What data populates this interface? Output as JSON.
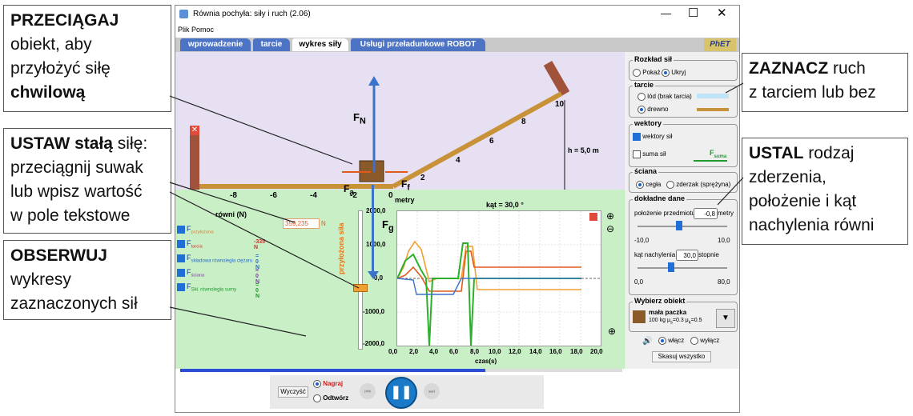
{
  "callouts": {
    "drag": {
      "bold": "PRZECIĄGAJ",
      "text1": "obiekt, aby",
      "text2": "przyłożyć siłę",
      "bold2": "chwilową"
    },
    "set": {
      "bold": "USTAW stałą",
      "text1": " siłę:",
      "text2": "przeciągnij suwak",
      "text3": "lub wpisz wartość",
      "text4": "w pole tekstowe"
    },
    "observe": {
      "bold": "OBSERWUJ",
      "text1": "wykresy",
      "text2": "zaznaczonych sił"
    },
    "mark": {
      "bold": "ZAZNACZ",
      "text1": " ruch",
      "text2": "z tarciem lub bez"
    },
    "determine": {
      "bold": "USTAL",
      "text1": " rodzaj",
      "text2": "zderzenia,",
      "text3": "położenie i kąt",
      "text4": "nachylenia równi"
    }
  },
  "window": {
    "title": "Równia pochyła: siły i ruch (2.06)",
    "menu": [
      "Plik",
      "Pomoc"
    ],
    "tabs": [
      "wprowadzenie",
      "tarcie",
      "wykres siły",
      "Usługi przeładunkowe ROBOT"
    ],
    "logo": "PhET"
  },
  "scene": {
    "ruler_labels": [
      "-8",
      "-6",
      "-4",
      "-2",
      "0",
      "2",
      "4",
      "6",
      "8",
      "10"
    ],
    "ruler_unit": "metry",
    "height_label": "h = 5,0 m",
    "angle_label": "kąt = 30,0 °",
    "force_fn": "F",
    "force_fn_sub": "N",
    "force_fa": "F",
    "force_fa_sub": "a",
    "force_ff": "F",
    "force_ff_sub": "f",
    "force_fg": "F",
    "force_fg_sub": "g"
  },
  "legend": {
    "header": "równi (N)",
    "applied_value": "359,235",
    "applied_unit": "N",
    "rows": [
      {
        "sym": "F",
        "sub": "przyłożona",
        "value": ""
      },
      {
        "sym": "F",
        "sub": "tarcia",
        "value": "-335 N"
      },
      {
        "sym": "F",
        "sub": "składowa równoległa ciężaru",
        "value": "= 0 N"
      },
      {
        "sym": "F",
        "sub": "ściana",
        "value": "= 0 N"
      },
      {
        "sym": "F",
        "sub": "Skł. równoległa sumy",
        "value": "= 0 N"
      }
    ],
    "slider_label": "przyłożona siła"
  },
  "graph": {
    "y_ticks": [
      "2000,0",
      "1000,0",
      "0,0",
      "-1000,0",
      "-2000,0"
    ],
    "x_ticks": [
      "0,0",
      "2,0",
      "4,0",
      "6,0",
      "8,0",
      "10,0",
      "12,0",
      "14,0",
      "16,0",
      "18,0",
      "20,0"
    ],
    "x_label": "czas(s)"
  },
  "panel": {
    "rozklad": {
      "title": "Rozkład sił",
      "options": [
        "Pokaż",
        "Ukryj"
      ],
      "selected": 1
    },
    "tarcie": {
      "title": "tarcie",
      "options": [
        "lód (brak tarcia)",
        "drewno"
      ],
      "selected": 1
    },
    "wektory": {
      "title": "wektory",
      "items": [
        "wektory sił",
        "suma sił"
      ],
      "checked": [
        true,
        false
      ],
      "sum_label": "F",
      "sum_sub": "suma"
    },
    "sciana": {
      "title": "ściana",
      "options": [
        "cegła",
        "zderzak (sprężyna)"
      ],
      "selected": 0
    },
    "dane": {
      "title": "dokładne dane",
      "position_label": "położenie przedmiotu",
      "position_value": "-0,8",
      "position_unit": "metry",
      "position_min": "-10,0",
      "position_max": "10,0",
      "position_fraction": 0.46,
      "angle_label": "kąt nachylenia",
      "angle_value": "30,0",
      "angle_unit": "stopnie",
      "angle_min": "0,0",
      "angle_max": "80,0",
      "angle_fraction": 0.375
    },
    "obiekt": {
      "title": "Wybierz obiekt",
      "name": "mała paczka",
      "details": "100 kg μ",
      "mu_s_sub": "s",
      "mu_s_val": "=0.3 μ",
      "mu_k_sub": "k",
      "mu_k_val": "=0.5"
    },
    "sound": {
      "on": "włącz",
      "off": "wyłącz",
      "selected": 0
    },
    "reset": "Skasuj wszystko"
  },
  "bottom": {
    "clear": "Wyczyść",
    "record": "Nagraj",
    "playback": "Odtwórz",
    "progress_fraction": 0.69
  },
  "colors": {
    "tab": "#4d74c4",
    "scene": "#e7dff2",
    "ground": "#c8efc6",
    "ramp": "#c89238",
    "vector": "#3b73c9",
    "applied": "#e05a1e"
  }
}
